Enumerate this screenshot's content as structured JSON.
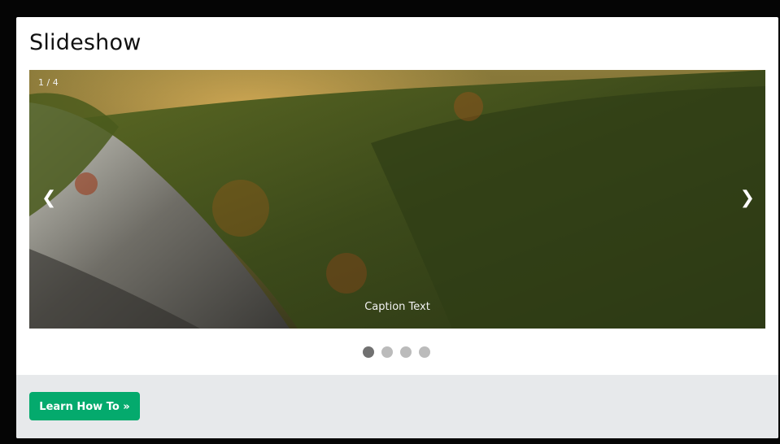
{
  "title": "Slideshow",
  "slideshow": {
    "counter": "1 / 4",
    "caption": "Caption Text",
    "prev_label": "❮",
    "next_label": "❯",
    "dots": [
      {
        "active": true
      },
      {
        "active": false
      },
      {
        "active": false
      },
      {
        "active": false
      }
    ]
  },
  "footer": {
    "button_label": "Learn How To »"
  },
  "colors": {
    "accent_button": "#04aa6d",
    "dot_active": "#717171",
    "dot_inactive": "#bbbbbb",
    "footer_bg": "#e7e9eb"
  }
}
